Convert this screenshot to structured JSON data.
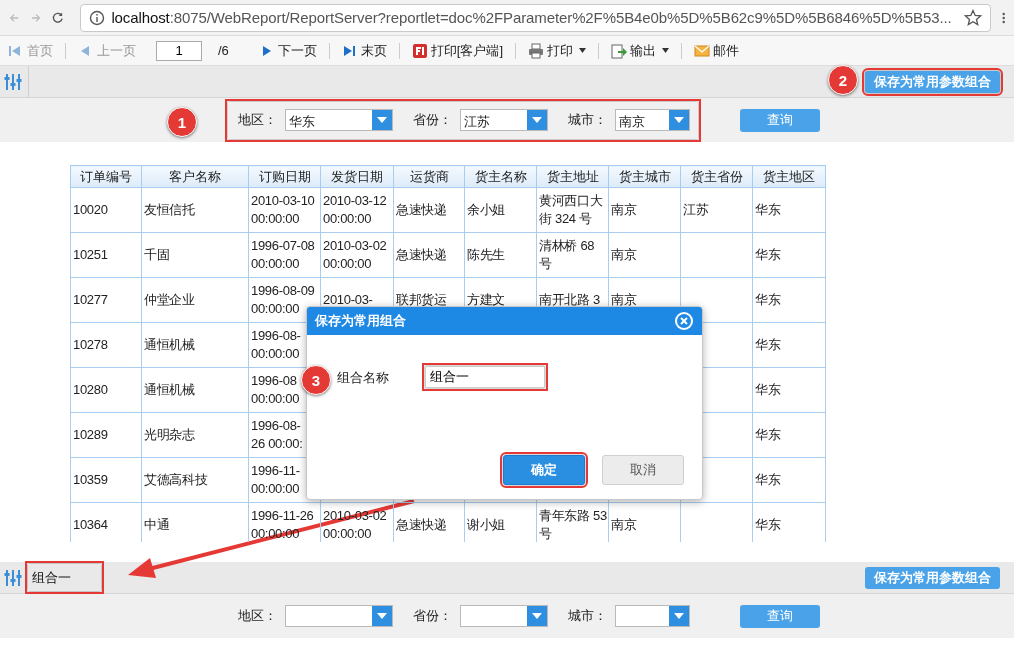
{
  "browser": {
    "url": "**localhost**:8075/WebReport/ReportServer?reportlet=doc%2FParameter%2F%5B4e0b%5D%5B62c9%5D%5B6846%5D%5B53..."
  },
  "toolbar": {
    "items": [
      {
        "kind": "button",
        "label": "首页",
        "disabled": true,
        "menu": false
      },
      {
        "kind": "button",
        "label": "上一页",
        "disabled": true,
        "menu": false
      },
      {
        "kind": "page",
        "value": "1",
        "total": "/6"
      },
      {
        "kind": "button",
        "label": "下一页",
        "disabled": false,
        "menu": false
      },
      {
        "kind": "button",
        "label": "末页",
        "disabled": false,
        "menu": false
      },
      {
        "kind": "button",
        "label": "打印[客户端]",
        "disabled": false,
        "menu": false
      },
      {
        "kind": "button",
        "label": "打印",
        "disabled": false,
        "menu": true
      },
      {
        "kind": "button",
        "label": "输出",
        "disabled": false,
        "menu": true
      },
      {
        "kind": "button",
        "label": "邮件",
        "disabled": false,
        "menu": false
      }
    ]
  },
  "param_panels": [
    {
      "save_button": "保存为常用参数组合",
      "save_highlighted": true,
      "fields_highlighted": true,
      "query_button": "查询",
      "fields": [
        {
          "label": "地区：",
          "value": "华东"
        },
        {
          "label": "省份：",
          "value": "江苏"
        },
        {
          "label": "城市：",
          "value": "南京"
        }
      ]
    },
    {
      "combo_label": "组合一",
      "combo_highlighted": true,
      "save_button": "保存为常用参数组合",
      "save_highlighted": false,
      "fields_highlighted": false,
      "query_button": "查询",
      "fields": [
        {
          "label": "地区："
        },
        {
          "label": "省份："
        },
        {
          "label": "城市："
        }
      ]
    }
  ],
  "table": {
    "columns": [
      "订单编号",
      "客户名称",
      "订购日期",
      "发货日期",
      "运货商",
      "货主名称",
      "货主地址",
      "货主城市",
      "货主省份",
      "货主地区"
    ],
    "rows": [
      {
        "order_id": "10020",
        "customer": "友恒信托",
        "order_date": "2010-03-10 00:00:00",
        "ship_date": "2010-03-12 00:00:00",
        "shipper": "急速快递",
        "ship_name": "余小姐",
        "address": "黄河西口大街 324 号",
        "city": "南京",
        "province": "江苏",
        "region": "华东"
      },
      {
        "order_id": "10251",
        "customer": "千固",
        "order_date": "1996-07-08 00:00:00",
        "ship_date": "2010-03-02 00:00:00",
        "shipper": "急速快递",
        "ship_name": "陈先生",
        "address": "清林桥 68 号",
        "city": "南京",
        "region": "华东"
      },
      {
        "order_id": "10277",
        "customer": "仲堂企业",
        "order_date": "1996-08-09 00:00:00",
        "ship_date": "2010-03-",
        "shipper": "联邦货运",
        "ship_name": "方建文",
        "address": "南开北路 3",
        "city": "南京",
        "region": "华东"
      },
      {
        "order_id": "10278",
        "customer": "通恒机械",
        "order_date": "1996-08- 00:00:00",
        "region": "华东"
      },
      {
        "order_id": "10280",
        "customer": "通恒机械",
        "order_date": "1996-08 00:00:00",
        "region": "华东"
      },
      {
        "order_id": "10289",
        "customer": "光明杂志",
        "order_date": "1996-08-\n26 00:00:",
        "region": "华东"
      },
      {
        "order_id": "10359",
        "customer": "艾德高科技",
        "order_date": "1996-11- 00:00:00",
        "region": "华东"
      },
      {
        "order_id": "10364",
        "customer": "中通",
        "order_date": "1996-11-26 00:00:00",
        "ship_date": "2010-03-02 00:00:00",
        "shipper": "急速快递",
        "ship_name": "谢小姐",
        "address": "青年东路 53 号",
        "city": "南京",
        "region": "华东"
      }
    ]
  },
  "dialog": {
    "title": "保存为常用组合",
    "field_label": "组合名称",
    "field_value": "组合一",
    "field_highlighted": true,
    "buttons": [
      {
        "label": "确定",
        "kind": "primary",
        "highlighted": true
      },
      {
        "label": "取消",
        "kind": "secondary",
        "highlighted": false
      }
    ]
  },
  "annotations": [
    {
      "number": "1"
    },
    {
      "number": "2"
    },
    {
      "number": "3"
    }
  ]
}
